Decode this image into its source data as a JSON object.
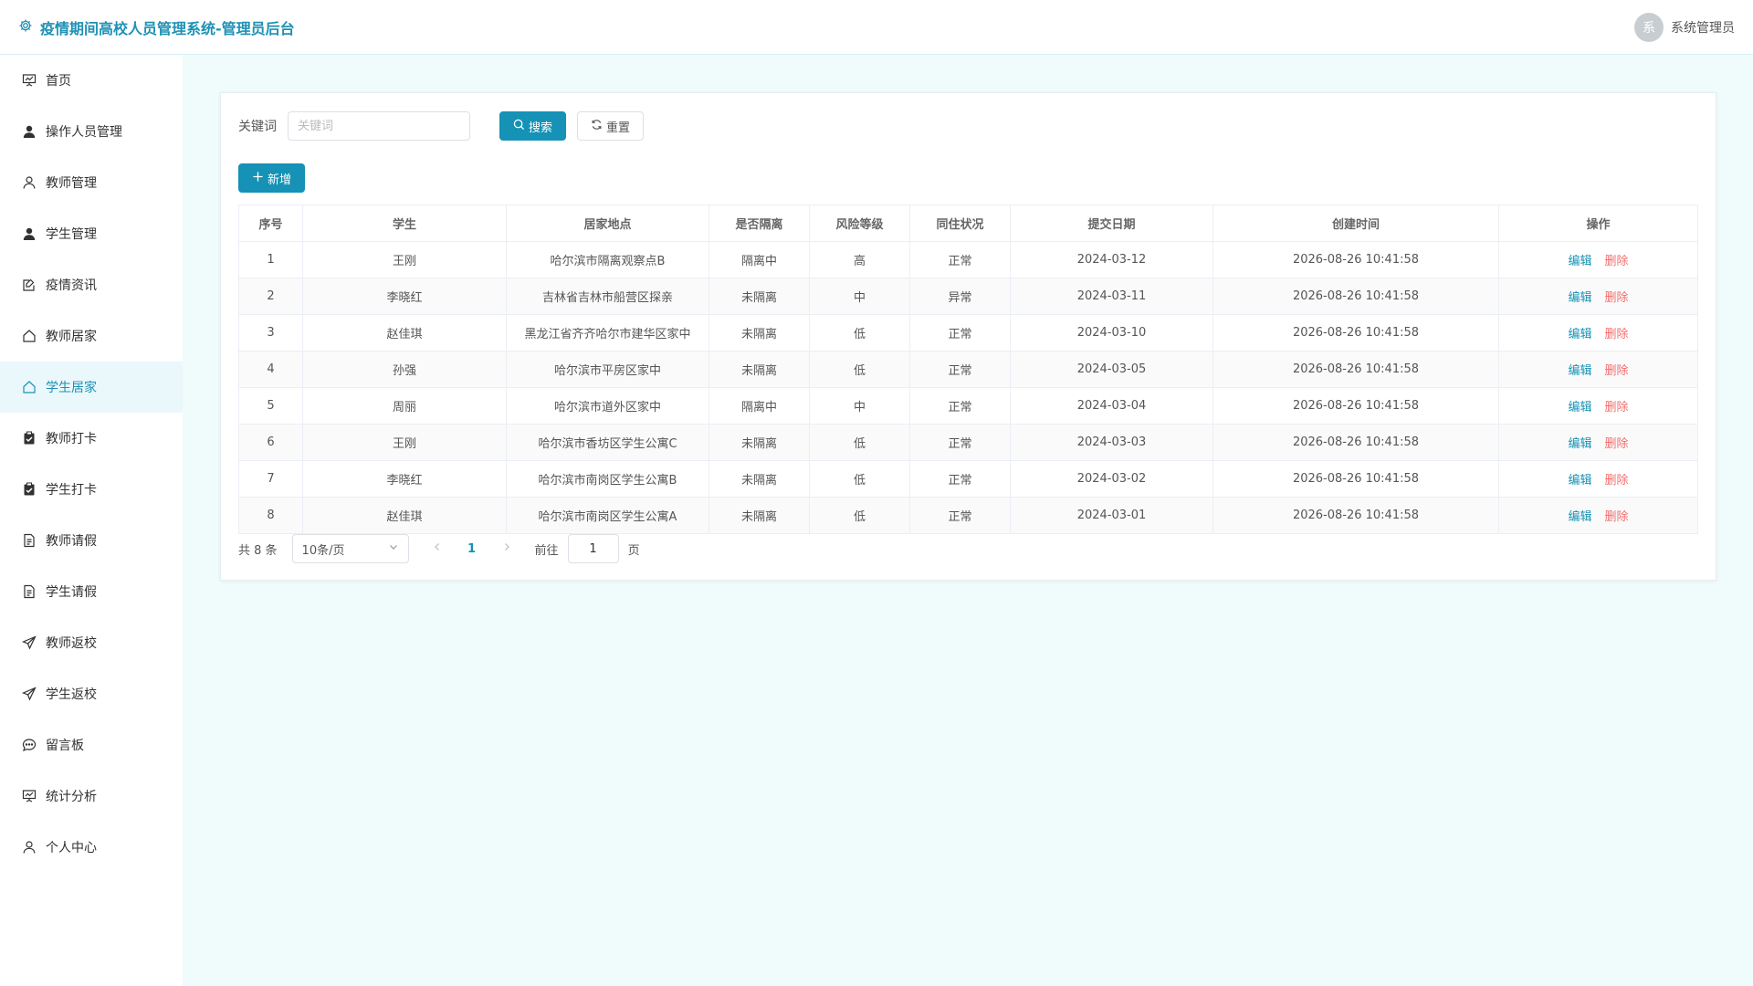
{
  "header": {
    "title": "疫情期间高校人员管理系统-管理员后台",
    "avatar_text": "系",
    "user_name": "系统管理员"
  },
  "sidebar": {
    "items": [
      {
        "label": "首页",
        "icon": "presentation-icon"
      },
      {
        "label": "操作人员管理",
        "icon": "user-filled-icon"
      },
      {
        "label": "教师管理",
        "icon": "user-icon"
      },
      {
        "label": "学生管理",
        "icon": "user-filled-icon"
      },
      {
        "label": "疫情资讯",
        "icon": "edit-note-icon"
      },
      {
        "label": "教师居家",
        "icon": "house-icon"
      },
      {
        "label": "学生居家",
        "icon": "house-icon",
        "active": true
      },
      {
        "label": "教师打卡",
        "icon": "clipboard-check-icon"
      },
      {
        "label": "学生打卡",
        "icon": "clipboard-check-icon"
      },
      {
        "label": "教师请假",
        "icon": "document-icon"
      },
      {
        "label": "学生请假",
        "icon": "document-icon"
      },
      {
        "label": "教师返校",
        "icon": "send-icon"
      },
      {
        "label": "学生返校",
        "icon": "send-icon"
      },
      {
        "label": "留言板",
        "icon": "chat-icon"
      },
      {
        "label": "统计分析",
        "icon": "presentation-icon"
      },
      {
        "label": "个人中心",
        "icon": "user-icon"
      }
    ]
  },
  "search": {
    "label": "关键词",
    "placeholder": "关键词",
    "value": "",
    "search_label": "搜索",
    "reset_label": "重置"
  },
  "toolbar": {
    "add_label": "新增"
  },
  "table": {
    "columns": [
      "序号",
      "学生",
      "居家地点",
      "是否隔离",
      "风险等级",
      "同住状况",
      "提交日期",
      "创建时间",
      "操作"
    ],
    "edit_label": "编辑",
    "delete_label": "删除",
    "rows": [
      [
        "1",
        "王刚",
        "哈尔滨市隔离观察点B",
        "隔离中",
        "高",
        "正常",
        "2024-03-12",
        "2026-08-26 10:41:58"
      ],
      [
        "2",
        "李晓红",
        "吉林省吉林市船营区探亲",
        "未隔离",
        "中",
        "异常",
        "2024-03-11",
        "2026-08-26 10:41:58"
      ],
      [
        "3",
        "赵佳琪",
        "黑龙江省齐齐哈尔市建华区家中",
        "未隔离",
        "低",
        "正常",
        "2024-03-10",
        "2026-08-26 10:41:58"
      ],
      [
        "4",
        "孙强",
        "哈尔滨市平房区家中",
        "未隔离",
        "低",
        "正常",
        "2024-03-05",
        "2026-08-26 10:41:58"
      ],
      [
        "5",
        "周丽",
        "哈尔滨市道外区家中",
        "隔离中",
        "中",
        "正常",
        "2024-03-04",
        "2026-08-26 10:41:58"
      ],
      [
        "6",
        "王刚",
        "哈尔滨市香坊区学生公寓C",
        "未隔离",
        "低",
        "正常",
        "2024-03-03",
        "2026-08-26 10:41:58"
      ],
      [
        "7",
        "李晓红",
        "哈尔滨市南岗区学生公寓B",
        "未隔离",
        "低",
        "正常",
        "2024-03-02",
        "2026-08-26 10:41:58"
      ],
      [
        "8",
        "赵佳琪",
        "哈尔滨市南岗区学生公寓A",
        "未隔离",
        "低",
        "正常",
        "2024-03-01",
        "2026-08-26 10:41:58"
      ]
    ]
  },
  "pagination": {
    "total_text": "共 8 条",
    "page_size": "10条/页",
    "current_page": "1",
    "goto_label": "前往",
    "goto_value": "1",
    "goto_unit": "页"
  },
  "colors": {
    "brand": "#1e91b5",
    "primary": "#1592b5",
    "danger": "#f56c6c",
    "background": "#f0fbfb"
  }
}
